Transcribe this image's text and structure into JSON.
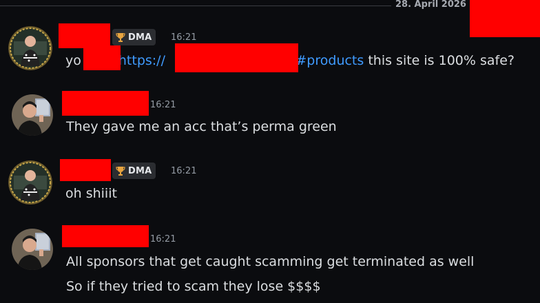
{
  "header": {
    "date": "28. April 2026"
  },
  "messages": [
    {
      "author_badge": "DMA",
      "badge_icon": "trophy-icon",
      "time": "16:21",
      "text_before": "yo",
      "link_protocol": "https://",
      "link_tail": "/#products",
      "text_after": " this site is 100% safe?"
    },
    {
      "time": "16:21",
      "text": "They gave me an acc that’s perma green"
    },
    {
      "author_badge": "DMA",
      "badge_icon": "trophy-icon",
      "time": "16:21",
      "text": "oh shiiit"
    },
    {
      "time": "16:21",
      "lines": [
        "All sponsors that get caught scamming get terminated as well",
        "So if they tried to scam they lose $$$$"
      ]
    }
  ],
  "colors": {
    "background": "#0b0c0f",
    "link": "#3f9bff",
    "redaction": "#ff0000",
    "badge_bg": "#2b2d31",
    "trophy": "#e8a540"
  }
}
